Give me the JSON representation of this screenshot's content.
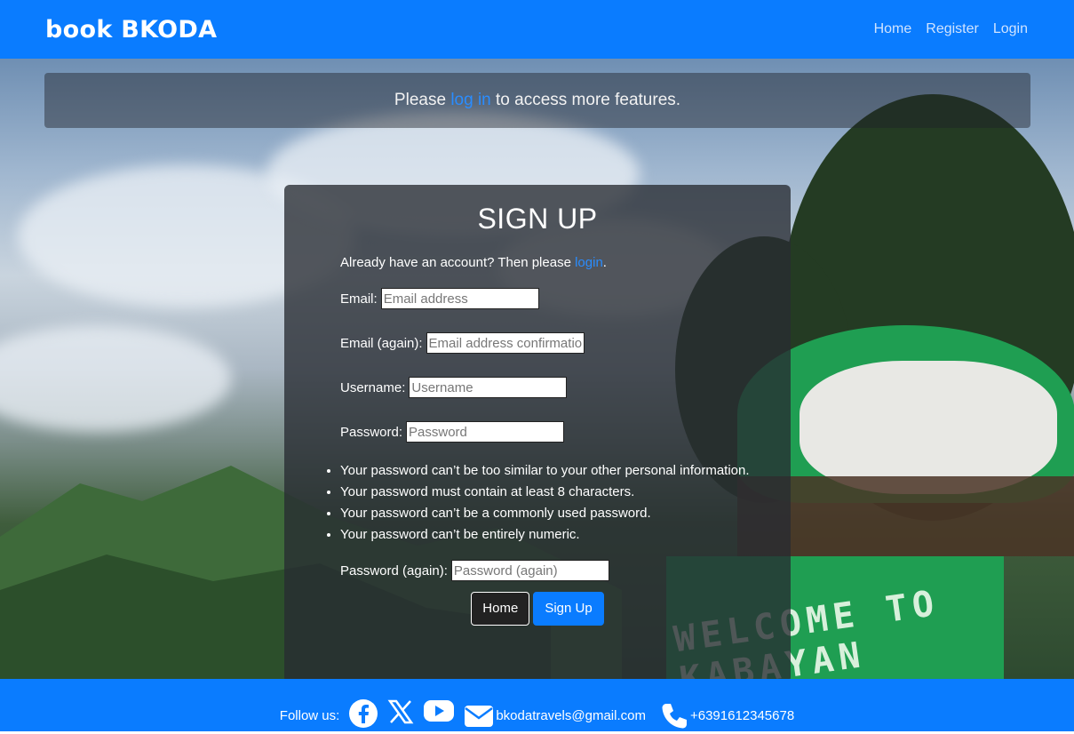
{
  "navbar": {
    "brand": "book BKODA",
    "links": [
      "Home",
      "Register",
      "Login"
    ]
  },
  "alert": {
    "before": "Please",
    "link": "log in",
    "after": "to access more features."
  },
  "signup": {
    "title": "SIGN UP",
    "already_text": "Already have an account? Then please",
    "already_link": "login",
    "already_end": ".",
    "fields": {
      "email": {
        "label": "Email:",
        "placeholder": "Email address"
      },
      "email2": {
        "label": "Email (again):",
        "placeholder": "Email address confirmation"
      },
      "username": {
        "label": "Username:",
        "placeholder": "Username"
      },
      "password": {
        "label": "Password:",
        "placeholder": "Password"
      },
      "password2": {
        "label": "Password (again):",
        "placeholder": "Password (again)"
      }
    },
    "rules": [
      "Your password can’t be too similar to your other personal information.",
      "Your password must contain at least 8 characters.",
      "Your password can’t be a commonly used password.",
      "Your password can’t be entirely numeric."
    ],
    "buttons": {
      "home": "Home",
      "signup": "Sign Up"
    }
  },
  "footer": {
    "follow": "Follow us:",
    "email": "bkodatravels@gmail.com",
    "phone": "+6391612345678",
    "icons": [
      "facebook-icon",
      "x-icon",
      "youtube-icon",
      "envelope-icon",
      "phone-icon"
    ]
  },
  "colors": {
    "primary": "#0a7cff",
    "link": "#2a8dff"
  },
  "background_sign_text": "WELCOME TO KABAYAN"
}
